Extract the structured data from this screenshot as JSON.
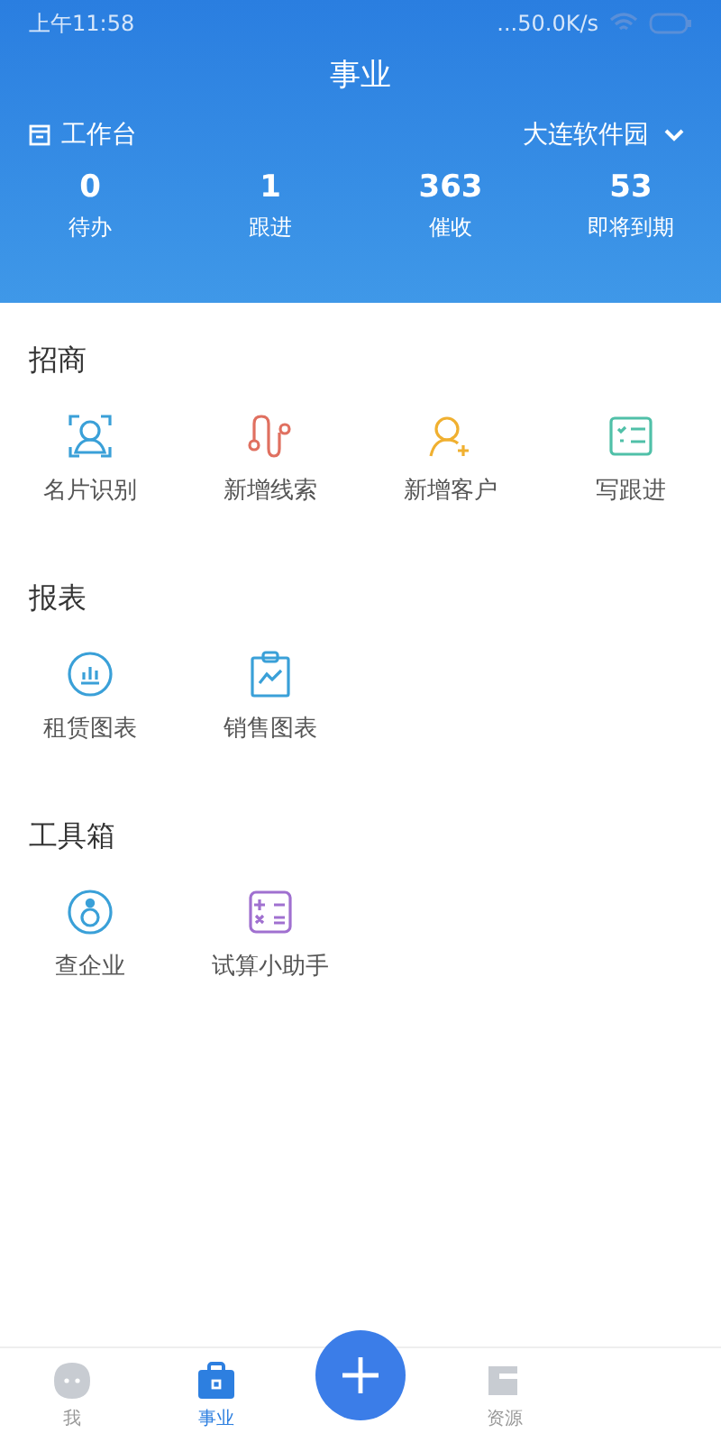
{
  "status_bar": {
    "time": "上午11:58",
    "network_speed": "...50.0K/s"
  },
  "header": {
    "title": "事业",
    "workspace_label": "工作台",
    "location": "大连软件园",
    "stats": [
      {
        "value": "0",
        "label": "待办"
      },
      {
        "value": "1",
        "label": "跟进"
      },
      {
        "value": "363",
        "label": "催收"
      },
      {
        "value": "53",
        "label": "即将到期"
      }
    ]
  },
  "sections": [
    {
      "title": "招商",
      "items": [
        {
          "label": "名片识别",
          "kind": "card-scan"
        },
        {
          "label": "新增线索",
          "kind": "clue"
        },
        {
          "label": "新增客户",
          "kind": "add-user"
        },
        {
          "label": "写跟进",
          "kind": "checklist"
        }
      ]
    },
    {
      "title": "报表",
      "items": [
        {
          "label": "租赁图表",
          "kind": "bar-chart"
        },
        {
          "label": "销售图表",
          "kind": "clipboard-chart"
        }
      ]
    },
    {
      "title": "工具箱",
      "items": [
        {
          "label": "查企业",
          "kind": "person-circle"
        },
        {
          "label": "试算小助手",
          "kind": "calculator"
        }
      ]
    }
  ],
  "bottom_nav": [
    {
      "kind": "profile",
      "label": "我",
      "selected": false
    },
    {
      "kind": "work",
      "label": "事业",
      "selected": true
    },
    {
      "kind": "add",
      "selected": false
    },
    {
      "kind": "resources",
      "label": "资源",
      "selected": false
    }
  ]
}
